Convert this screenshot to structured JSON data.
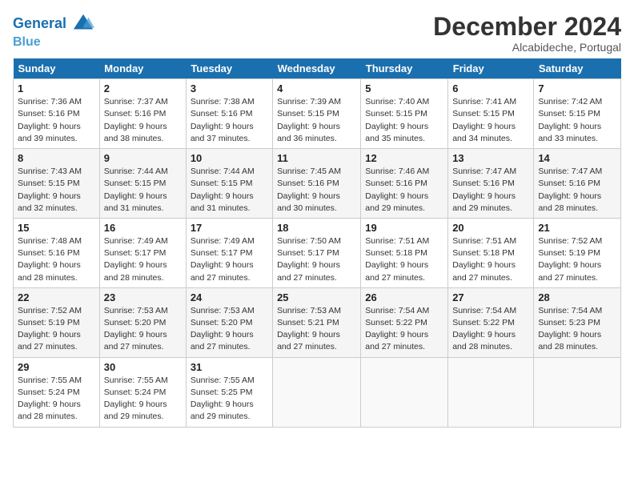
{
  "header": {
    "logo_line1": "General",
    "logo_line2": "Blue",
    "month": "December 2024",
    "location": "Alcabideche, Portugal"
  },
  "days_of_week": [
    "Sunday",
    "Monday",
    "Tuesday",
    "Wednesday",
    "Thursday",
    "Friday",
    "Saturday"
  ],
  "weeks": [
    [
      {
        "day": "1",
        "sunrise": "7:36 AM",
        "sunset": "5:16 PM",
        "daylight": "9 hours and 39 minutes."
      },
      {
        "day": "2",
        "sunrise": "7:37 AM",
        "sunset": "5:16 PM",
        "daylight": "9 hours and 38 minutes."
      },
      {
        "day": "3",
        "sunrise": "7:38 AM",
        "sunset": "5:16 PM",
        "daylight": "9 hours and 37 minutes."
      },
      {
        "day": "4",
        "sunrise": "7:39 AM",
        "sunset": "5:15 PM",
        "daylight": "9 hours and 36 minutes."
      },
      {
        "day": "5",
        "sunrise": "7:40 AM",
        "sunset": "5:15 PM",
        "daylight": "9 hours and 35 minutes."
      },
      {
        "day": "6",
        "sunrise": "7:41 AM",
        "sunset": "5:15 PM",
        "daylight": "9 hours and 34 minutes."
      },
      {
        "day": "7",
        "sunrise": "7:42 AM",
        "sunset": "5:15 PM",
        "daylight": "9 hours and 33 minutes."
      }
    ],
    [
      {
        "day": "8",
        "sunrise": "7:43 AM",
        "sunset": "5:15 PM",
        "daylight": "9 hours and 32 minutes."
      },
      {
        "day": "9",
        "sunrise": "7:44 AM",
        "sunset": "5:15 PM",
        "daylight": "9 hours and 31 minutes."
      },
      {
        "day": "10",
        "sunrise": "7:44 AM",
        "sunset": "5:15 PM",
        "daylight": "9 hours and 31 minutes."
      },
      {
        "day": "11",
        "sunrise": "7:45 AM",
        "sunset": "5:16 PM",
        "daylight": "9 hours and 30 minutes."
      },
      {
        "day": "12",
        "sunrise": "7:46 AM",
        "sunset": "5:16 PM",
        "daylight": "9 hours and 29 minutes."
      },
      {
        "day": "13",
        "sunrise": "7:47 AM",
        "sunset": "5:16 PM",
        "daylight": "9 hours and 29 minutes."
      },
      {
        "day": "14",
        "sunrise": "7:47 AM",
        "sunset": "5:16 PM",
        "daylight": "9 hours and 28 minutes."
      }
    ],
    [
      {
        "day": "15",
        "sunrise": "7:48 AM",
        "sunset": "5:16 PM",
        "daylight": "9 hours and 28 minutes."
      },
      {
        "day": "16",
        "sunrise": "7:49 AM",
        "sunset": "5:17 PM",
        "daylight": "9 hours and 28 minutes."
      },
      {
        "day": "17",
        "sunrise": "7:49 AM",
        "sunset": "5:17 PM",
        "daylight": "9 hours and 27 minutes."
      },
      {
        "day": "18",
        "sunrise": "7:50 AM",
        "sunset": "5:17 PM",
        "daylight": "9 hours and 27 minutes."
      },
      {
        "day": "19",
        "sunrise": "7:51 AM",
        "sunset": "5:18 PM",
        "daylight": "9 hours and 27 minutes."
      },
      {
        "day": "20",
        "sunrise": "7:51 AM",
        "sunset": "5:18 PM",
        "daylight": "9 hours and 27 minutes."
      },
      {
        "day": "21",
        "sunrise": "7:52 AM",
        "sunset": "5:19 PM",
        "daylight": "9 hours and 27 minutes."
      }
    ],
    [
      {
        "day": "22",
        "sunrise": "7:52 AM",
        "sunset": "5:19 PM",
        "daylight": "9 hours and 27 minutes."
      },
      {
        "day": "23",
        "sunrise": "7:53 AM",
        "sunset": "5:20 PM",
        "daylight": "9 hours and 27 minutes."
      },
      {
        "day": "24",
        "sunrise": "7:53 AM",
        "sunset": "5:20 PM",
        "daylight": "9 hours and 27 minutes."
      },
      {
        "day": "25",
        "sunrise": "7:53 AM",
        "sunset": "5:21 PM",
        "daylight": "9 hours and 27 minutes."
      },
      {
        "day": "26",
        "sunrise": "7:54 AM",
        "sunset": "5:22 PM",
        "daylight": "9 hours and 27 minutes."
      },
      {
        "day": "27",
        "sunrise": "7:54 AM",
        "sunset": "5:22 PM",
        "daylight": "9 hours and 28 minutes."
      },
      {
        "day": "28",
        "sunrise": "7:54 AM",
        "sunset": "5:23 PM",
        "daylight": "9 hours and 28 minutes."
      }
    ],
    [
      {
        "day": "29",
        "sunrise": "7:55 AM",
        "sunset": "5:24 PM",
        "daylight": "9 hours and 28 minutes."
      },
      {
        "day": "30",
        "sunrise": "7:55 AM",
        "sunset": "5:24 PM",
        "daylight": "9 hours and 29 minutes."
      },
      {
        "day": "31",
        "sunrise": "7:55 AM",
        "sunset": "5:25 PM",
        "daylight": "9 hours and 29 minutes."
      },
      null,
      null,
      null,
      null
    ]
  ]
}
